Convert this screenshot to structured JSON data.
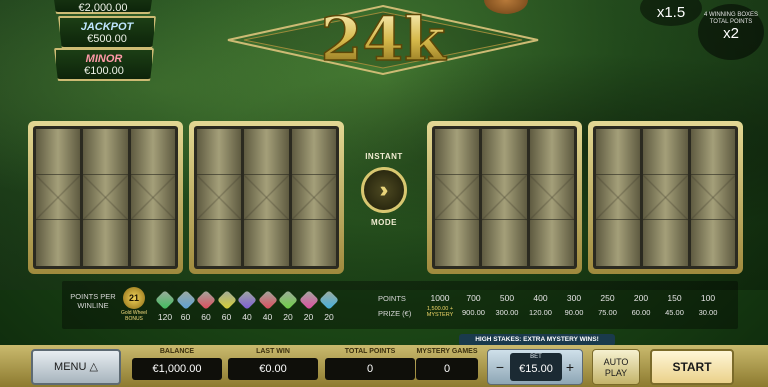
{
  "jackpots": {
    "grand": {
      "amount": "€2,000.00"
    },
    "jackpot": {
      "name": "JACKPOT",
      "amount": "€500.00"
    },
    "minor": {
      "name": "MINOR",
      "amount": "€100.00"
    }
  },
  "logo": {
    "text": "24k"
  },
  "multiplier": "x1.5",
  "bonus": {
    "caption": "4 WINNING BOXES TOTAL POINTS",
    "value": "x2"
  },
  "instant": {
    "top": "INSTANT",
    "bottom": "MODE",
    "icon": "double-chevron-right"
  },
  "paytable": {
    "left_label": "POINTS PER WINLINE",
    "gold_wheel": {
      "symbol": "21",
      "label": "Gold Wheel BONUS"
    },
    "gems": [
      {
        "value": "120",
        "color": "#3bbf5a"
      },
      {
        "value": "60",
        "color": "#5aa0d8"
      },
      {
        "value": "60",
        "color": "#e0485a"
      },
      {
        "value": "60",
        "color": "#d8d030"
      },
      {
        "value": "40",
        "color": "#7d5ad8"
      },
      {
        "value": "40",
        "color": "#e0485a"
      },
      {
        "value": "20",
        "color": "#6ad040"
      },
      {
        "value": "20",
        "color": "#e04aa0"
      },
      {
        "value": "20",
        "color": "#40b0e0"
      }
    ],
    "points_label": "POINTS",
    "prize_label": "PRIZE (€)",
    "prizes": [
      {
        "points": "1000",
        "prize": "1,500.00 + MYSTERY",
        "gold": true
      },
      {
        "points": "700",
        "prize": "900.00"
      },
      {
        "points": "500",
        "prize": "300.00"
      },
      {
        "points": "400",
        "prize": "120.00"
      },
      {
        "points": "300",
        "prize": "90.00"
      },
      {
        "points": "250",
        "prize": "75.00"
      },
      {
        "points": "200",
        "prize": "60.00"
      },
      {
        "points": "150",
        "prize": "45.00"
      },
      {
        "points": "100",
        "prize": "30.00"
      }
    ]
  },
  "high_stakes": "HIGH STAKES: EXTRA MYSTERY WINS!",
  "footer": {
    "menu": "MENU",
    "balance": {
      "label": "BALANCE",
      "value": "€1,000.00"
    },
    "last_win": {
      "label": "LAST WIN",
      "value": "€0.00"
    },
    "total_points": {
      "label": "TOTAL POINTS",
      "value": "0"
    },
    "mystery_games": {
      "label": "MYSTERY GAMES",
      "value": "0"
    },
    "bet": {
      "label": "BET",
      "value": "€15.00",
      "minus": "−",
      "plus": "+"
    },
    "auto_play": "AUTO PLAY",
    "start": "START"
  },
  "colors": {
    "felt": "#1f4d18",
    "gold": "#cdbb74",
    "bar": "#caba6e"
  }
}
